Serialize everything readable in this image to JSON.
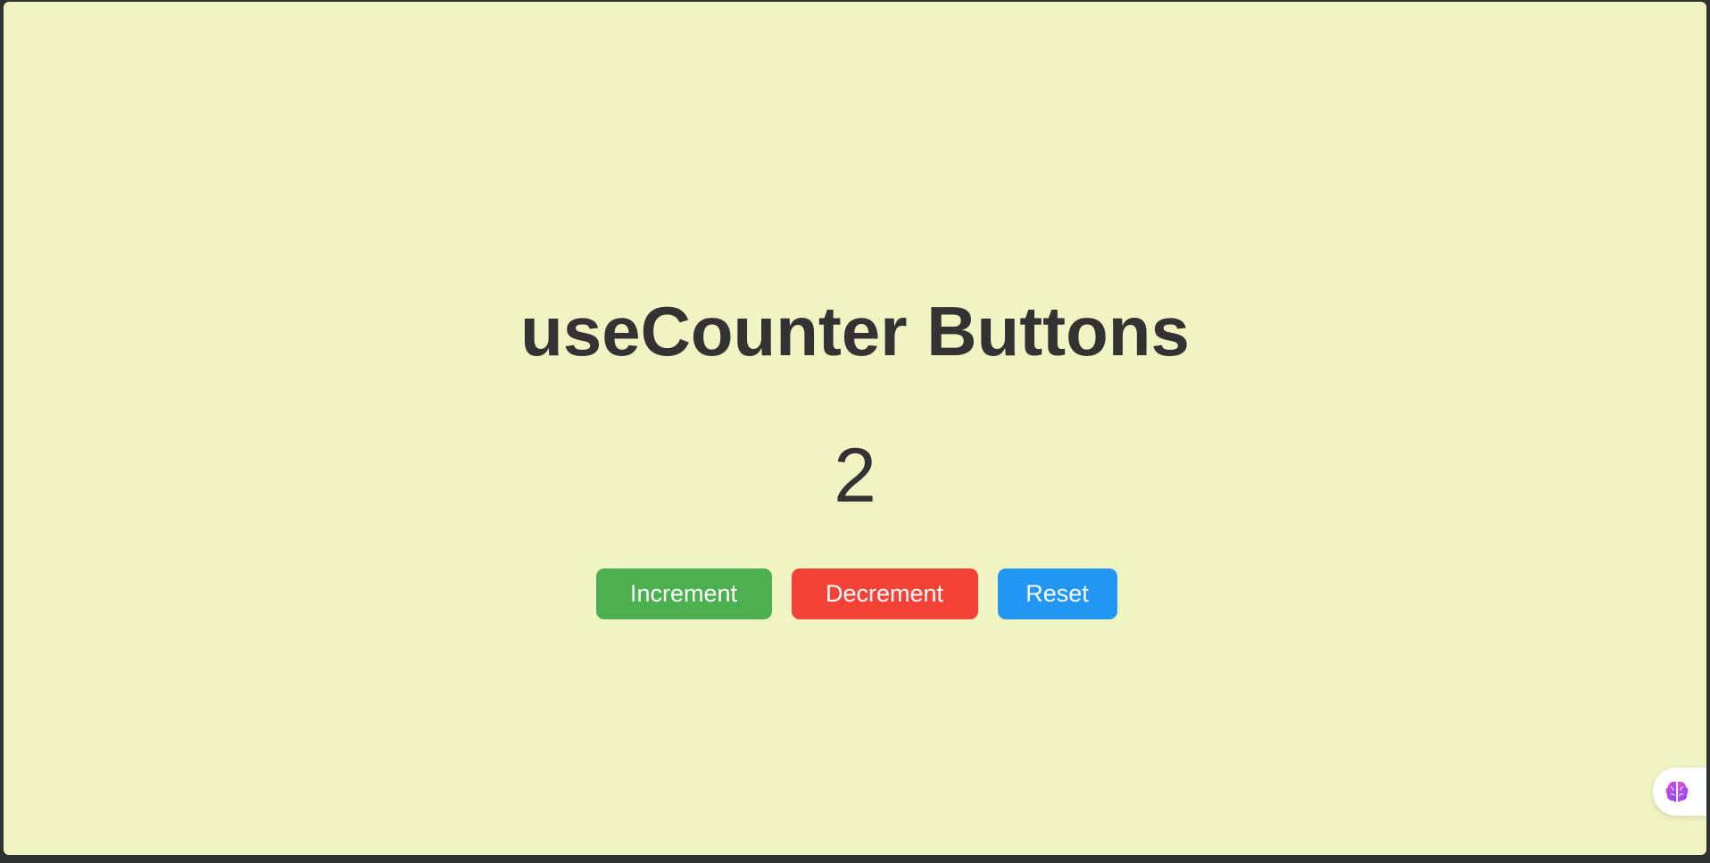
{
  "page": {
    "title": "useCounter Buttons",
    "count": "2"
  },
  "buttons": {
    "increment_label": "Increment",
    "decrement_label": "Decrement",
    "reset_label": "Reset"
  },
  "colors": {
    "background": "#f0f4c3",
    "increment": "#4caf50",
    "decrement": "#f44336",
    "reset": "#2196f3",
    "text": "#333333"
  },
  "icons": {
    "floating_button": "brain-icon"
  }
}
